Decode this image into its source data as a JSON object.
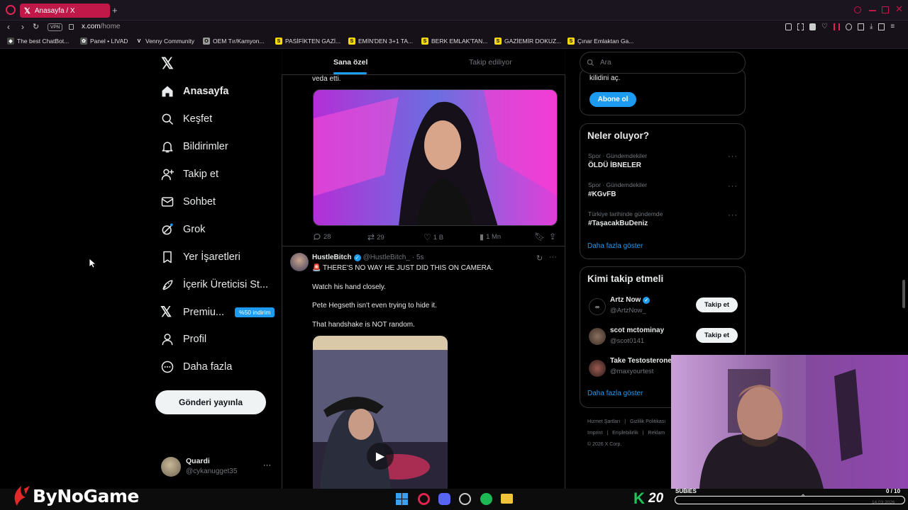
{
  "browser": {
    "tab_title": "Anasayfa / X",
    "new_tab": "+",
    "url_host": "x.com",
    "url_path": "/home",
    "vpn": "VPN",
    "bookmarks": [
      "The best ChatBot...",
      "Panel • LIVAD",
      "Venny Community",
      "OEM Tır/Kamyon...",
      "PASİFİKTEN GAZİ...",
      "EMİN'DEN 3+1 TA...",
      "BERK EMLAK'TAN...",
      "GAZİEMİR DOKUZ...",
      "Çınar Emlaktan Ga..."
    ]
  },
  "nav": {
    "items": [
      "Anasayfa",
      "Keşfet",
      "Bildirimler",
      "Takip et",
      "Sohbet",
      "Grok",
      "Yer İşaretleri",
      "İçerik Üreticisi St...",
      "Premiu...",
      "Profil",
      "Daha fazla"
    ],
    "premium_badge": "%50 indirim",
    "post_button": "Gönderi yayınla",
    "user": {
      "name": "Quardi",
      "handle": "@cykanugget35",
      "more": "···"
    }
  },
  "feed": {
    "tabs": [
      "Sana özel",
      "Takip ediliyor"
    ],
    "tweet1": {
      "tail_text": "veda etti.",
      "replies": "28",
      "retweets": "29",
      "likes": "1 B",
      "views": "1 Mn"
    },
    "tweet2": {
      "name": "HustleBitch",
      "handle": "@HustleBitch_",
      "time": "· 5s",
      "lines": [
        "🚨 THERE'S NO WAY HE JUST DID THIS ON CAMERA.",
        "Watch his hand closely.",
        "Pete Hegseth isn't even trying to hide it.",
        "That handshake is NOT random."
      ],
      "more": "···"
    }
  },
  "right": {
    "search_placeholder": "Ara",
    "premium_text": "kilidini aç.",
    "subscribe": "Abone ol",
    "trends_title": "Neler oluyor?",
    "trends": [
      {
        "category": "Spor · Gündemdekiler",
        "tag": "ÖLDÜ İBNELER"
      },
      {
        "category": "Spor · Gündemdekiler",
        "tag": "#KGvFB"
      },
      {
        "category": "Türkiye tarihinde gündemde",
        "tag": "#TaşacakBuDeniz"
      }
    ],
    "trend_more": "···",
    "show_more": "Daha fazla göster",
    "who_title": "Kimi takip etmeli",
    "who": [
      {
        "name": "Artz Now",
        "handle": "@ArtzNow_",
        "button": "Takip et"
      },
      {
        "name": "scot mctominay",
        "handle": "@scot0141",
        "button": "Takip et"
      },
      {
        "name": "Take Testosterone",
        "handle": "@maxyourtest"
      }
    ],
    "who_more": "Daha fazla göster",
    "footer": [
      "Hizmet Şartları",
      "|",
      "Gizlilik Politikası",
      "Imprint",
      "|",
      "Erişilebilirlik",
      "|",
      "Reklam",
      "© 2026 X Corp."
    ]
  },
  "overlay": {
    "logo": "ByNoGame",
    "k_count": "20",
    "k_letter": "K",
    "subs_label": "SUBIES",
    "subs_count": "0 / 10",
    "date": "14.03.2026"
  },
  "colors": {
    "accent": "#1d9bf0",
    "tab_red": "#c1184a",
    "k_green": "#21c45a"
  }
}
